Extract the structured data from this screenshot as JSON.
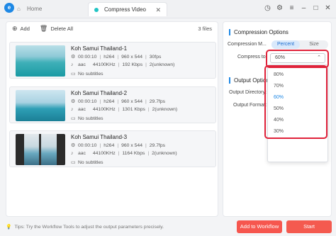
{
  "tabs": {
    "home": "Home",
    "active": "Compress Video"
  },
  "toolbar": {
    "add": "Add",
    "delete_all": "Delete All",
    "file_count": "3 files"
  },
  "files": [
    {
      "name": "Koh Samui Thailand-1",
      "duration": "00:00:10",
      "codec": "h264",
      "resolution": "960 x 544",
      "fps": "30fps",
      "audio_codec": "aac",
      "sample_rate": "44100KHz",
      "bitrate": "192 Kbps",
      "channels": "2(unknown)",
      "subtitles": "No subtitles"
    },
    {
      "name": "Koh Samui Thailand-2",
      "duration": "00:00:10",
      "codec": "h264",
      "resolution": "960 x 544",
      "fps": "29.7fps",
      "audio_codec": "aac",
      "sample_rate": "44100KHz",
      "bitrate": "1301 Kbps",
      "channels": "2(unknown)",
      "subtitles": "No subtitles"
    },
    {
      "name": "Koh Samui Thailand-3",
      "duration": "00:00:10",
      "codec": "h264",
      "resolution": "960 x 544",
      "fps": "29.7fps",
      "audio_codec": "aac",
      "sample_rate": "44100KHz",
      "bitrate": "1164 Kbps",
      "channels": "2(unknown)",
      "subtitles": "No subtitles"
    }
  ],
  "compression": {
    "title": "Compression Options",
    "mode_label": "Compression M...",
    "mode_percent": "Percent",
    "mode_size": "Size",
    "compress_to_label": "Compress to:",
    "selected_value": "60%",
    "options": [
      "80%",
      "70%",
      "60%",
      "50%",
      "40%",
      "30%"
    ]
  },
  "output": {
    "title": "Output Options",
    "directory_label": "Output Directory:",
    "format_label": "Output Format:"
  },
  "footer": {
    "tip": "Tips: Try the Workflow Tools to adjust the output parameters precisely.",
    "add_to_workflow": "Add to Workflow",
    "start": "Start"
  },
  "colors": {
    "accent": "#1e88e5",
    "highlight": "#e0223a",
    "start_button": "#f45a4f"
  }
}
